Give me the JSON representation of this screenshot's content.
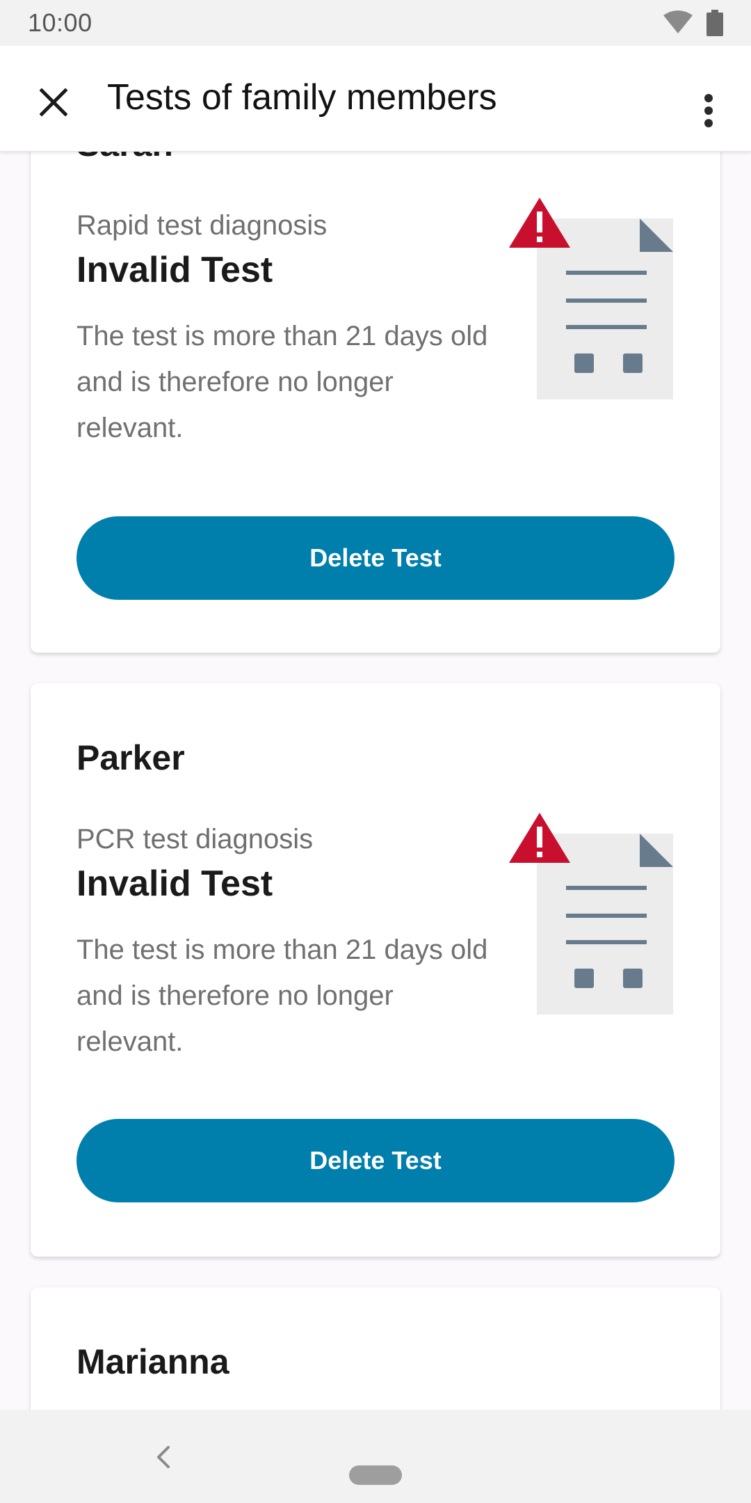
{
  "status_bar": {
    "time": "10:00"
  },
  "app_bar": {
    "title": "Tests of family members"
  },
  "cards": [
    {
      "name": "Sarah",
      "subtitle": "Rapid test diagnosis",
      "result": "Invalid Test",
      "description": "The test is more than 21 days old and is therefore no longer relevant.",
      "button_label": "Delete Test"
    },
    {
      "name": "Parker",
      "subtitle": "PCR test diagnosis",
      "result": "Invalid Test",
      "description": "The test is more than 21 days old and is therefore no longer relevant.",
      "button_label": "Delete Test"
    },
    {
      "name": "Marianna"
    }
  ],
  "icons": {
    "close": "close-icon",
    "menu": "more-vert-icon",
    "warning": "warning-triangle-icon",
    "document": "document-icon"
  },
  "colors": {
    "accent": "#007fad",
    "warning": "#c8102e",
    "doc_fold": "#677b8c"
  }
}
